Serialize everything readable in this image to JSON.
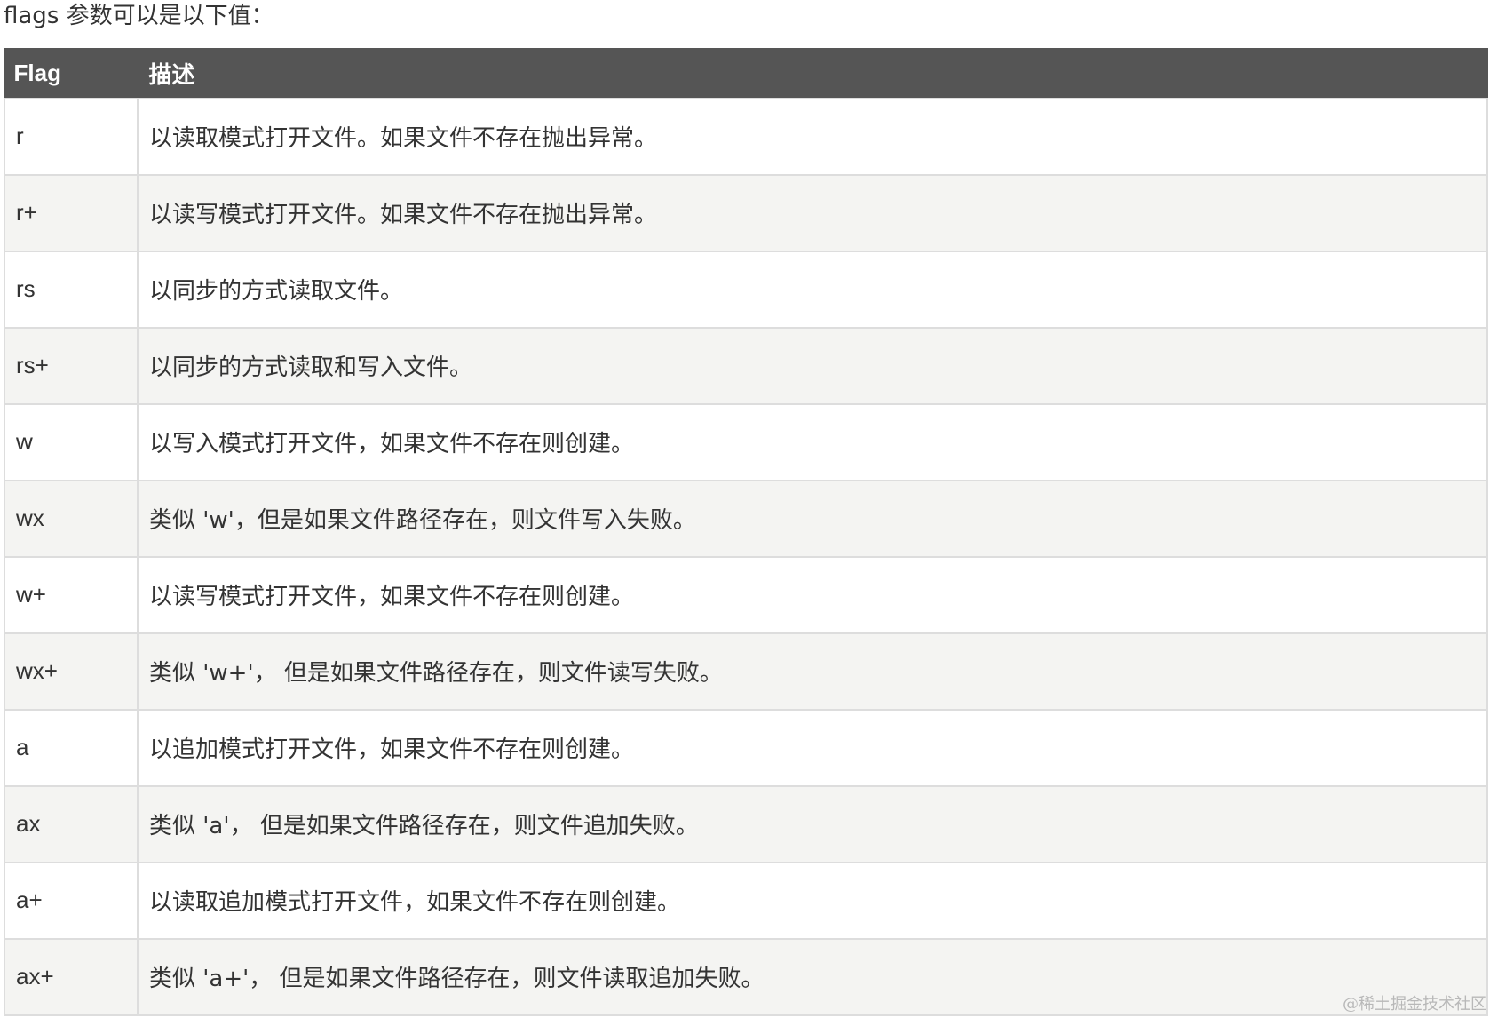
{
  "intro": "flags 参数可以是以下值：",
  "table": {
    "headers": [
      "Flag",
      "描述"
    ],
    "rows": [
      {
        "flag": "r",
        "desc": "以读取模式打开文件。如果文件不存在抛出异常。"
      },
      {
        "flag": "r+",
        "desc": "以读写模式打开文件。如果文件不存在抛出异常。"
      },
      {
        "flag": "rs",
        "desc": "以同步的方式读取文件。"
      },
      {
        "flag": "rs+",
        "desc": "以同步的方式读取和写入文件。"
      },
      {
        "flag": "w",
        "desc": "以写入模式打开文件，如果文件不存在则创建。"
      },
      {
        "flag": "wx",
        "desc": "类似 'w'，但是如果文件路径存在，则文件写入失败。"
      },
      {
        "flag": "w+",
        "desc": "以读写模式打开文件，如果文件不存在则创建。"
      },
      {
        "flag": "wx+",
        "desc": "类似 'w+'， 但是如果文件路径存在，则文件读写失败。"
      },
      {
        "flag": "a",
        "desc": "以追加模式打开文件，如果文件不存在则创建。"
      },
      {
        "flag": "ax",
        "desc": "类似 'a'， 但是如果文件路径存在，则文件追加失败。"
      },
      {
        "flag": "a+",
        "desc": "以读取追加模式打开文件，如果文件不存在则创建。"
      },
      {
        "flag": "ax+",
        "desc": "类似 'a+'， 但是如果文件路径存在，则文件读取追加失败。"
      }
    ]
  },
  "watermark": "@稀土掘金技术社区",
  "colors": {
    "header_bg": "#555555",
    "header_text": "#ffffff",
    "row_alt_bg": "#f4f4f2",
    "border": "#dddddd",
    "text": "#333333"
  }
}
